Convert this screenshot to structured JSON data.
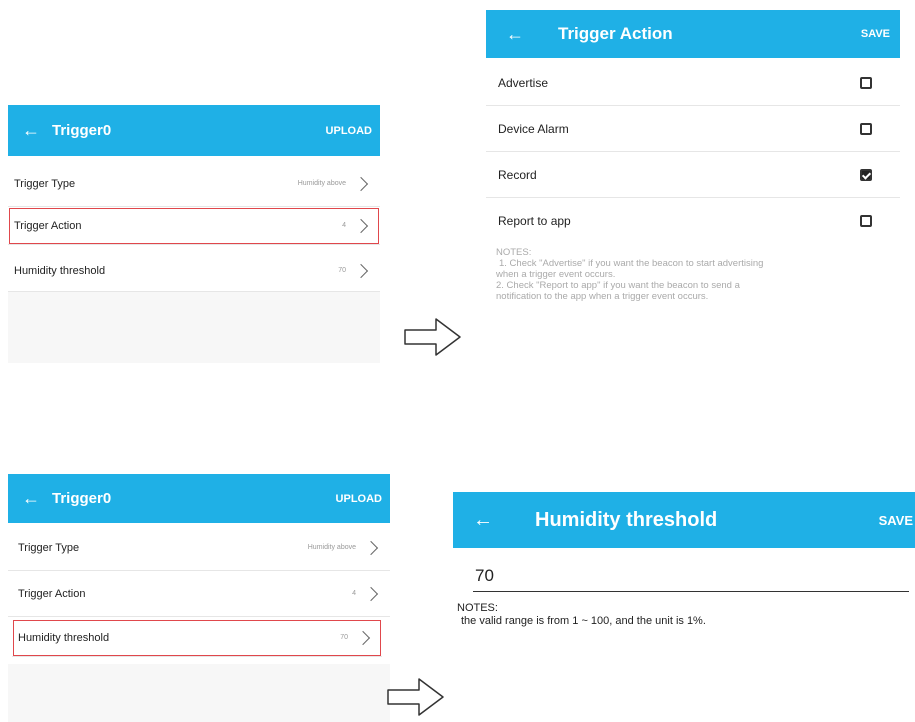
{
  "panel1": {
    "title": "Trigger0",
    "action": "UPLOAD",
    "rows": [
      {
        "label": "Trigger Type",
        "value": "Humidity above"
      },
      {
        "label": "Trigger Action",
        "value": "4"
      },
      {
        "label": "Humidity threshold",
        "value": "70"
      }
    ]
  },
  "panel2": {
    "title": "Trigger Action",
    "action": "SAVE",
    "options": [
      {
        "label": "Advertise",
        "checked": false
      },
      {
        "label": "Device Alarm",
        "checked": false
      },
      {
        "label": "Record",
        "checked": true
      },
      {
        "label": "Report to app",
        "checked": false
      }
    ],
    "notes_title": "NOTES:",
    "note1": "1. Check \"Advertise\" if you want the beacon to start advertising",
    "note1b": "when a trigger event occurs.",
    "note2": "2. Check \"Report to app\" if you want the beacon to send a",
    "note2b": "notification to the app when a trigger event occurs."
  },
  "panel3": {
    "title": "Trigger0",
    "action": "UPLOAD",
    "rows": [
      {
        "label": "Trigger Type",
        "value": "Humidity above"
      },
      {
        "label": "Trigger Action",
        "value": "4"
      },
      {
        "label": "Humidity threshold",
        "value": "70"
      }
    ]
  },
  "panel4": {
    "title": "Humidity threshold",
    "action": "SAVE",
    "input_value": "70",
    "notes_title": "NOTES:",
    "notes_text": "the valid range is from 1 ~ 100, and the unit is 1%."
  },
  "icons": {
    "back": "back-arrow-icon",
    "chevron": "chevron-right-icon",
    "flow": "flow-arrow-icon"
  },
  "colors": {
    "appbar": "#1fb0e6",
    "highlight": "#e0474c"
  }
}
